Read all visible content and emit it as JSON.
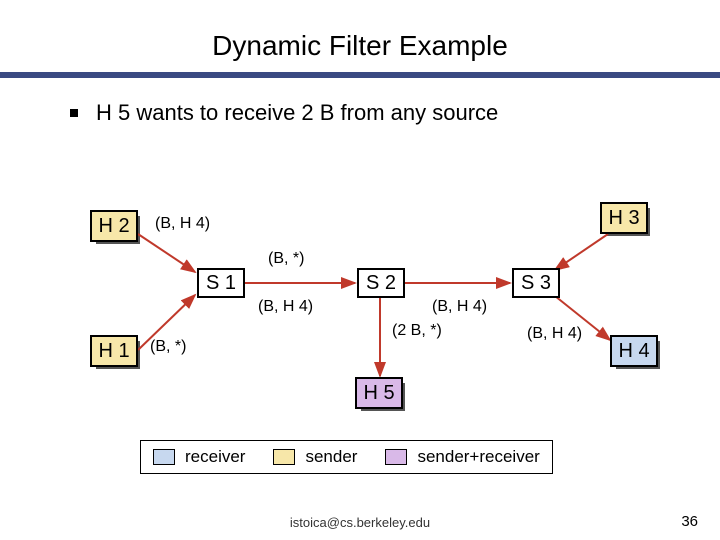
{
  "title": "Dynamic Filter Example",
  "bullet": "H 5 wants to receive 2 B from any source",
  "nodes": {
    "h1": "H 1",
    "h2": "H 2",
    "h3": "H 3",
    "h4": "H 4",
    "h5": "H 5",
    "s1": "S 1",
    "s2": "S 2",
    "s3": "S 3"
  },
  "labels": {
    "h2_s1": "(B, H 4)",
    "s1_s2_top": "(B, *)",
    "s1_s2_bot": "(B, H 4)",
    "h1_s1": "(B, *)",
    "s2_s3": "(B, H 4)",
    "s2_h5": "(2 B, *)",
    "s3_h4": "(B, H 4)"
  },
  "legend": {
    "receiver": "receiver",
    "sender": "sender",
    "both": "sender+receiver"
  },
  "footer": "istoica@cs.berkeley.edu",
  "page": "36"
}
